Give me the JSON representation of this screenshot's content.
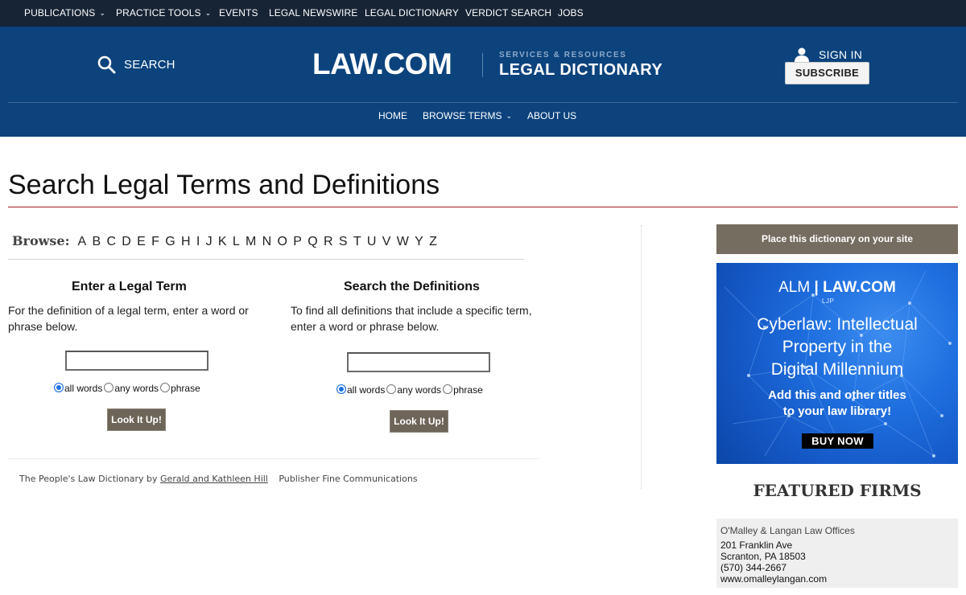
{
  "topnav": {
    "items": [
      "PUBLICATIONS",
      "PRACTICE TOOLS",
      "EVENTS",
      "LEGAL NEWSWIRE",
      "LEGAL DICTIONARY",
      "VERDICT SEARCH",
      "JOBS"
    ]
  },
  "header": {
    "search_label": "SEARCH",
    "logo": "LAW.COM",
    "services_label": "SERVICES & RESOURCES",
    "section_title": "LEGAL DICTIONARY",
    "signin_label": "SIGN IN",
    "subscribe_label": "SUBSCRIBE",
    "subnav": [
      "HOME",
      "BROWSE TERMS",
      "ABOUT US"
    ],
    "colors": {
      "topbar": "#162435",
      "header": "#0c437d",
      "accent_rule": "#a21d21"
    }
  },
  "page": {
    "title": "Search Legal Terms and Definitions",
    "browse_label": "Browse:",
    "letters": [
      "A",
      "B",
      "C",
      "D",
      "E",
      "F",
      "G",
      "H",
      "I",
      "J",
      "K",
      "L",
      "M",
      "N",
      "O",
      "P",
      "Q",
      "R",
      "S",
      "T",
      "U",
      "V",
      "W",
      "Y",
      "Z"
    ]
  },
  "term_search": {
    "title": "Enter a Legal Term",
    "description": "For the definition of a legal term, enter a word or phrase below.",
    "value": "",
    "options": [
      "all words",
      "any words",
      "phrase"
    ],
    "selected": "all words",
    "button": "Look It Up!"
  },
  "definition_search": {
    "title": "Search the Definitions",
    "description": "To find all definitions that include a specific term, enter a word or phrase below.",
    "value": "",
    "options": [
      "all words",
      "any words",
      "phrase"
    ],
    "selected": "all words",
    "button": "Look It Up!"
  },
  "footer": {
    "prefix": "The People's Law Dictionary by",
    "authors_link": "Gerald and Kathleen Hill",
    "publisher": "Publisher Fine Communications"
  },
  "sidebar": {
    "place_button": "Place this dictionary on your site",
    "ad": {
      "brand_alm": "ALM",
      "brand_lawcom": "LAW.COM",
      "brand_ljp": "LJP",
      "headline_lines": [
        "Cyberlaw: Intellectual",
        "Property in the",
        "Digital Millennium"
      ],
      "sub_lines": [
        "Add this and other titles",
        "to your law library!"
      ],
      "cta": "BUY NOW"
    },
    "featured_title": "FEATURED FIRMS",
    "firm": {
      "name": "O'Malley & Langan Law Offices",
      "address1": "201 Franklin Ave",
      "address2": "Scranton, PA 18503",
      "phone": "(570) 344-2667",
      "website": "www.omalleylangan.com"
    }
  }
}
